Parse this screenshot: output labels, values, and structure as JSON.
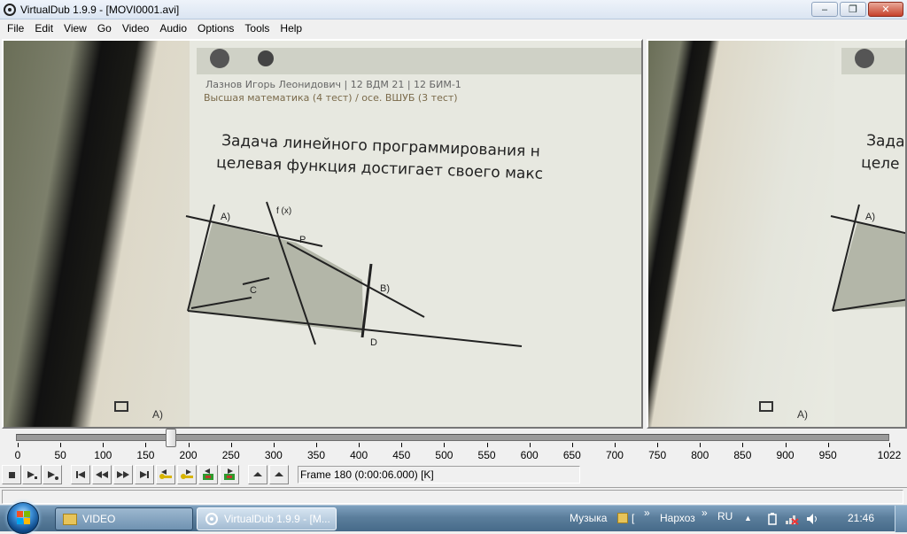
{
  "window": {
    "title": "VirtualDub 1.9.9 - [MOVI0001.avi]",
    "controls": {
      "minimize": "minimize",
      "maximize": "maximize",
      "close": "close"
    }
  },
  "menu": [
    "File",
    "Edit",
    "View",
    "Go",
    "Video",
    "Audio",
    "Options",
    "Tools",
    "Help"
  ],
  "timeline": {
    "current_frame": 180,
    "max_frame": 1022,
    "tick_labels": [
      "0",
      "50",
      "100",
      "150",
      "200",
      "250",
      "300",
      "350",
      "400",
      "450",
      "500",
      "550",
      "600",
      "650",
      "700",
      "750",
      "800",
      "850",
      "900",
      "950",
      "1022"
    ]
  },
  "frame_info": "Frame 180 (0:00:06.000) [K]",
  "toolbar": {
    "buttons": [
      "stop-icon",
      "play-input-icon",
      "play-output-icon",
      "go-start-icon",
      "prev-frame-icon",
      "next-frame-icon",
      "go-end-icon",
      "prev-keyframe-icon",
      "next-keyframe-icon",
      "prev-scene-icon",
      "next-scene-icon",
      "mark-in-icon",
      "mark-out-icon"
    ]
  },
  "video": {
    "line1": "Задача линейного программирования н",
    "line2": "целевая функция достигает своего макс",
    "line2_output": "целе",
    "line1_output": "Зада",
    "header1": "Лазнов Игорь Леонидович | 12 ВДМ 21 | 12 БИМ-1",
    "header2": "Высшая математика (4 тест) / осе. ВШУБ (3 тест)",
    "labels": {
      "f": "f (x)",
      "a": "A)",
      "b": "B)",
      "c": "C",
      "d": "D",
      "p": "P"
    },
    "footer_label": "A)"
  },
  "taskbar": {
    "items": [
      {
        "label": "VIDEO"
      },
      {
        "label": "VirtualDub 1.9.9 - [M..."
      }
    ],
    "tray": {
      "music": "Музыка",
      "arrows1": "»",
      "narkhoz": "Нархоз",
      "arrows2": "»",
      "lang": "RU",
      "clock": "21:46"
    }
  }
}
